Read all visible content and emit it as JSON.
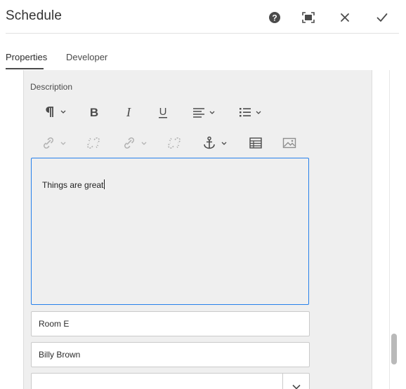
{
  "dialog": {
    "title": "Schedule",
    "help_icon": "help-icon",
    "fullscreen_icon": "fullscreen-icon",
    "close_icon": "close-icon",
    "done_icon": "checkmark-icon"
  },
  "tabs": [
    {
      "label": "Properties",
      "active": true
    },
    {
      "label": "Developer",
      "active": false
    }
  ],
  "description": {
    "label": "Description",
    "toolbar": {
      "row1": [
        "paragraph-format-icon",
        "bold-icon",
        "italic-icon",
        "underline-icon",
        "justify-icon",
        "list-icon"
      ],
      "row2": [
        "link-icon",
        "unlink-icon",
        "link-icon",
        "unlink-icon",
        "anchor-icon",
        "table-icon",
        "image-icon"
      ]
    },
    "text": "Things are great"
  },
  "fields": {
    "location": "Room E",
    "person": "Billy Brown",
    "select_value": ""
  },
  "colors": {
    "focus_border": "#2680eb",
    "panel_bg": "#efefef"
  }
}
